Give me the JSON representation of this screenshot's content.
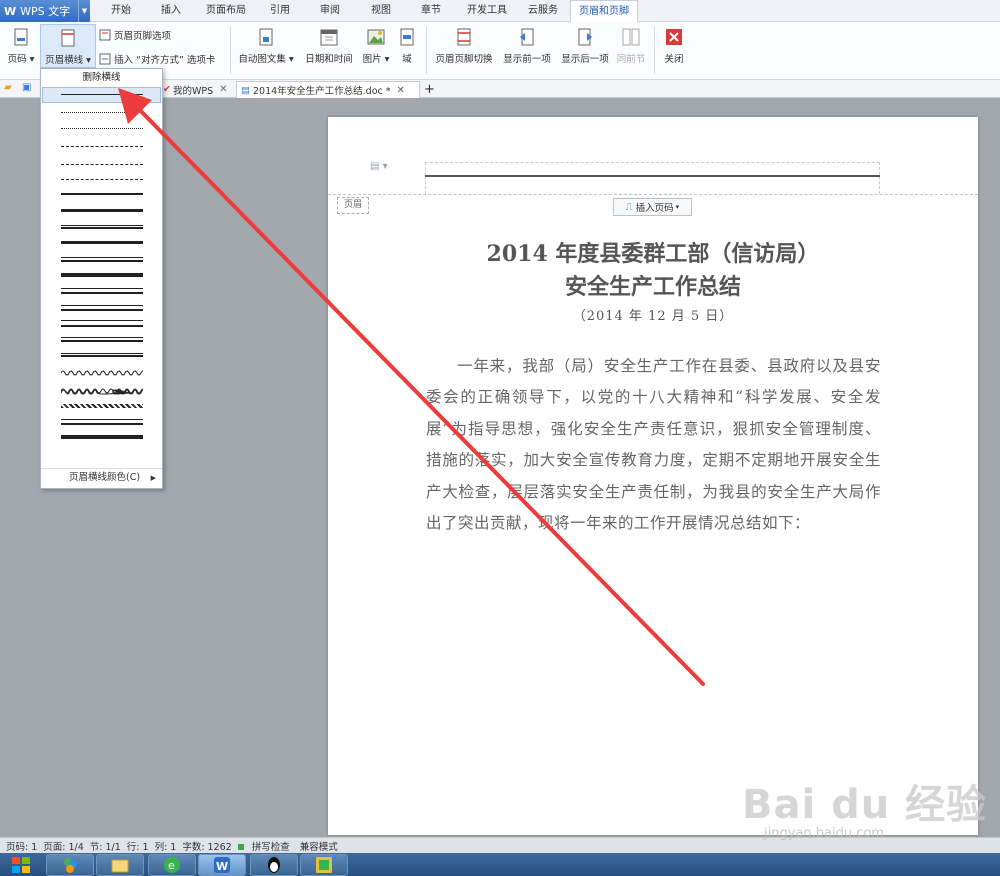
{
  "app": {
    "logo": "W",
    "name": "WPS 文字"
  },
  "menu": {
    "tabs": [
      "开始",
      "插入",
      "页面布局",
      "引用",
      "审阅",
      "视图",
      "章节",
      "开发工具",
      "云服务",
      "页眉和页脚"
    ],
    "active_tab": "页眉和页脚"
  },
  "ribbon": {
    "page_number": "页码",
    "header_line": "页眉横线",
    "header_footer_options": "页眉页脚选项",
    "insert_align_tab": "插入 “对齐方式” 选项卡",
    "auto_text": "自动图文集",
    "date_time": "日期和时间",
    "picture": "图片",
    "field": "域",
    "switch_header_footer": "页眉页脚切换",
    "show_previous": "显示前一项",
    "show_next": "显示后一项",
    "same_as_previous": "同前节",
    "close": "关闭"
  },
  "tabs": {
    "my_wps": "我的WPS",
    "doc_name": "2014年安全生产工作总结.doc *",
    "add": "+"
  },
  "dropdown": {
    "remove_line": "删除横线",
    "line_color": "页眉横线颜色(C)"
  },
  "document": {
    "header_label": "页眉",
    "insert_page_number": "插入页码",
    "title_line1": "2014 年度县委群工部（信访局）",
    "title_line2": "安全生产工作总结",
    "date": "（2014 年 12 月 5 日）",
    "body": "一年来，我部（局）安全生产工作在县委、县政府以及县安委会的正确领导下，以党的十八大精神和“科学发展、安全发展”为指导思想，强化安全生产责任意识，狠抓安全管理制度、措施的落实，加大安全宣传教育力度，定期不定期地开展安全生产大检查，层层落实安全生产责任制，为我县的安全生产大局作出了突出贡献，现将一年来的工作开展情况总结如下："
  },
  "status": {
    "page": "页码: 1",
    "pages": "页面: 1/4",
    "section": "节: 1/1",
    "row": "行: 1",
    "col": "列: 1",
    "words": "字数: 1262",
    "spell": "拼写检查",
    "compat": "兼容模式"
  },
  "watermark": {
    "logo": "Bai du 经验",
    "url": "jingyan.baidu.com"
  },
  "colors": {
    "accent": "#2f6bc1",
    "annotation_arrow": "#ee3b3b"
  }
}
